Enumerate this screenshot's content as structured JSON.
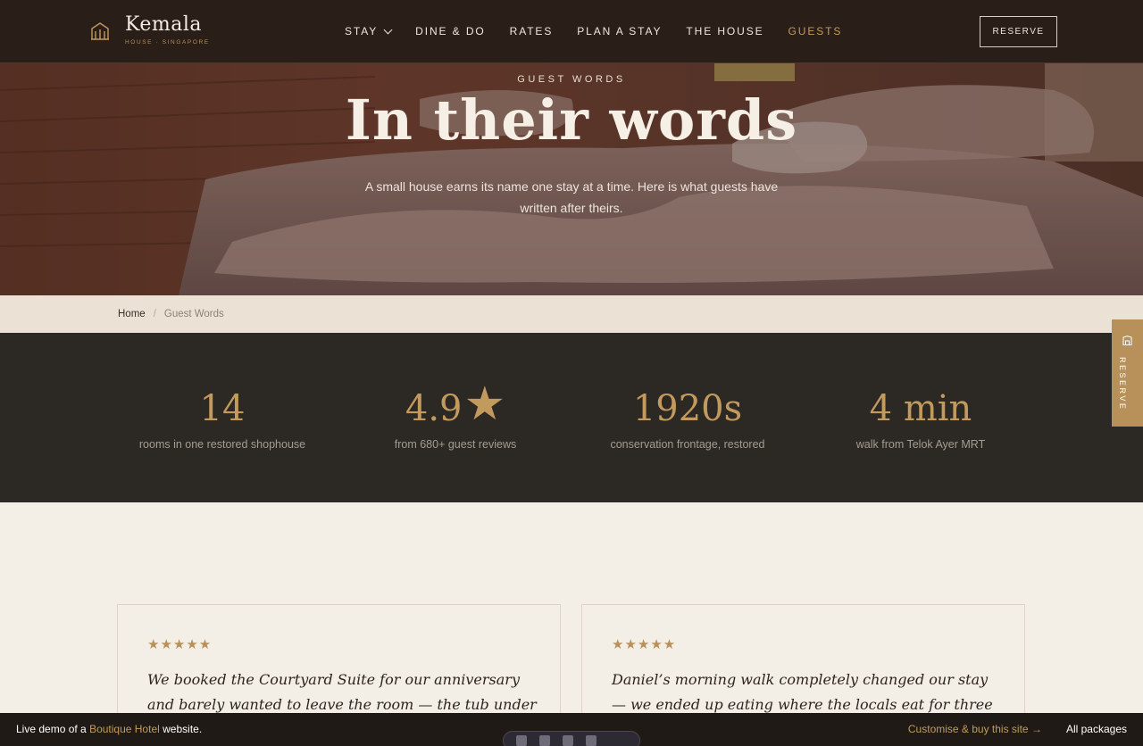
{
  "header": {
    "brand": "Kemala",
    "tagline": "HOUSE · SINGAPORE",
    "nav": [
      {
        "label": "STAY",
        "has_dropdown": true,
        "active": false
      },
      {
        "label": "DINE & DO",
        "has_dropdown": false,
        "active": false
      },
      {
        "label": "RATES",
        "has_dropdown": false,
        "active": false
      },
      {
        "label": "PLAN A STAY",
        "has_dropdown": false,
        "active": false
      },
      {
        "label": "THE HOUSE",
        "has_dropdown": false,
        "active": false
      },
      {
        "label": "GUESTS",
        "has_dropdown": false,
        "active": true
      }
    ],
    "reserve_label": "RESERVE"
  },
  "hero": {
    "eyebrow": "GUEST WORDS",
    "title": "In their words",
    "subtitle": "A small house earns its name one stay at a time. Here is what guests have written after theirs."
  },
  "breadcrumb": {
    "home": "Home",
    "separator": "/",
    "current": "Guest Words"
  },
  "stats": [
    {
      "value": "14",
      "label": "rooms in one restored shophouse"
    },
    {
      "value": "4.9",
      "suffix_icon": "star-icon",
      "suffix": "★",
      "label": "from 680+ guest reviews"
    },
    {
      "value": "1920s",
      "label": "conservation frontage, restored"
    },
    {
      "value": "4 min",
      "label": "walk from Telok Ayer MRT"
    }
  ],
  "side_tab": {
    "label": "RESERVE",
    "icon": "building-icon"
  },
  "reviews": [
    {
      "rating": 5,
      "stars": "★★★★★",
      "quote": "We booked the Courtyard Suite for our anniversary and barely wanted to leave the room — the tub under the old beams, the"
    },
    {
      "rating": 5,
      "stars": "★★★★★",
      "quote": "Daniel’s morning walk completely changed our stay — we ended up eating where the locals eat for three nights running. The room"
    }
  ],
  "demo_bar": {
    "prefix": "Live demo of a",
    "highlight": "Boutique Hotel",
    "suffix": "website.",
    "customise": "Customise & buy this site →",
    "packages": "All packages"
  },
  "colors": {
    "header_bg": "#2a1e18",
    "accent_gold": "#c39a5d",
    "stats_bg": "#2c2925",
    "page_bg": "#f3eee6",
    "breadcrumb_bg": "#ebe2d5"
  }
}
